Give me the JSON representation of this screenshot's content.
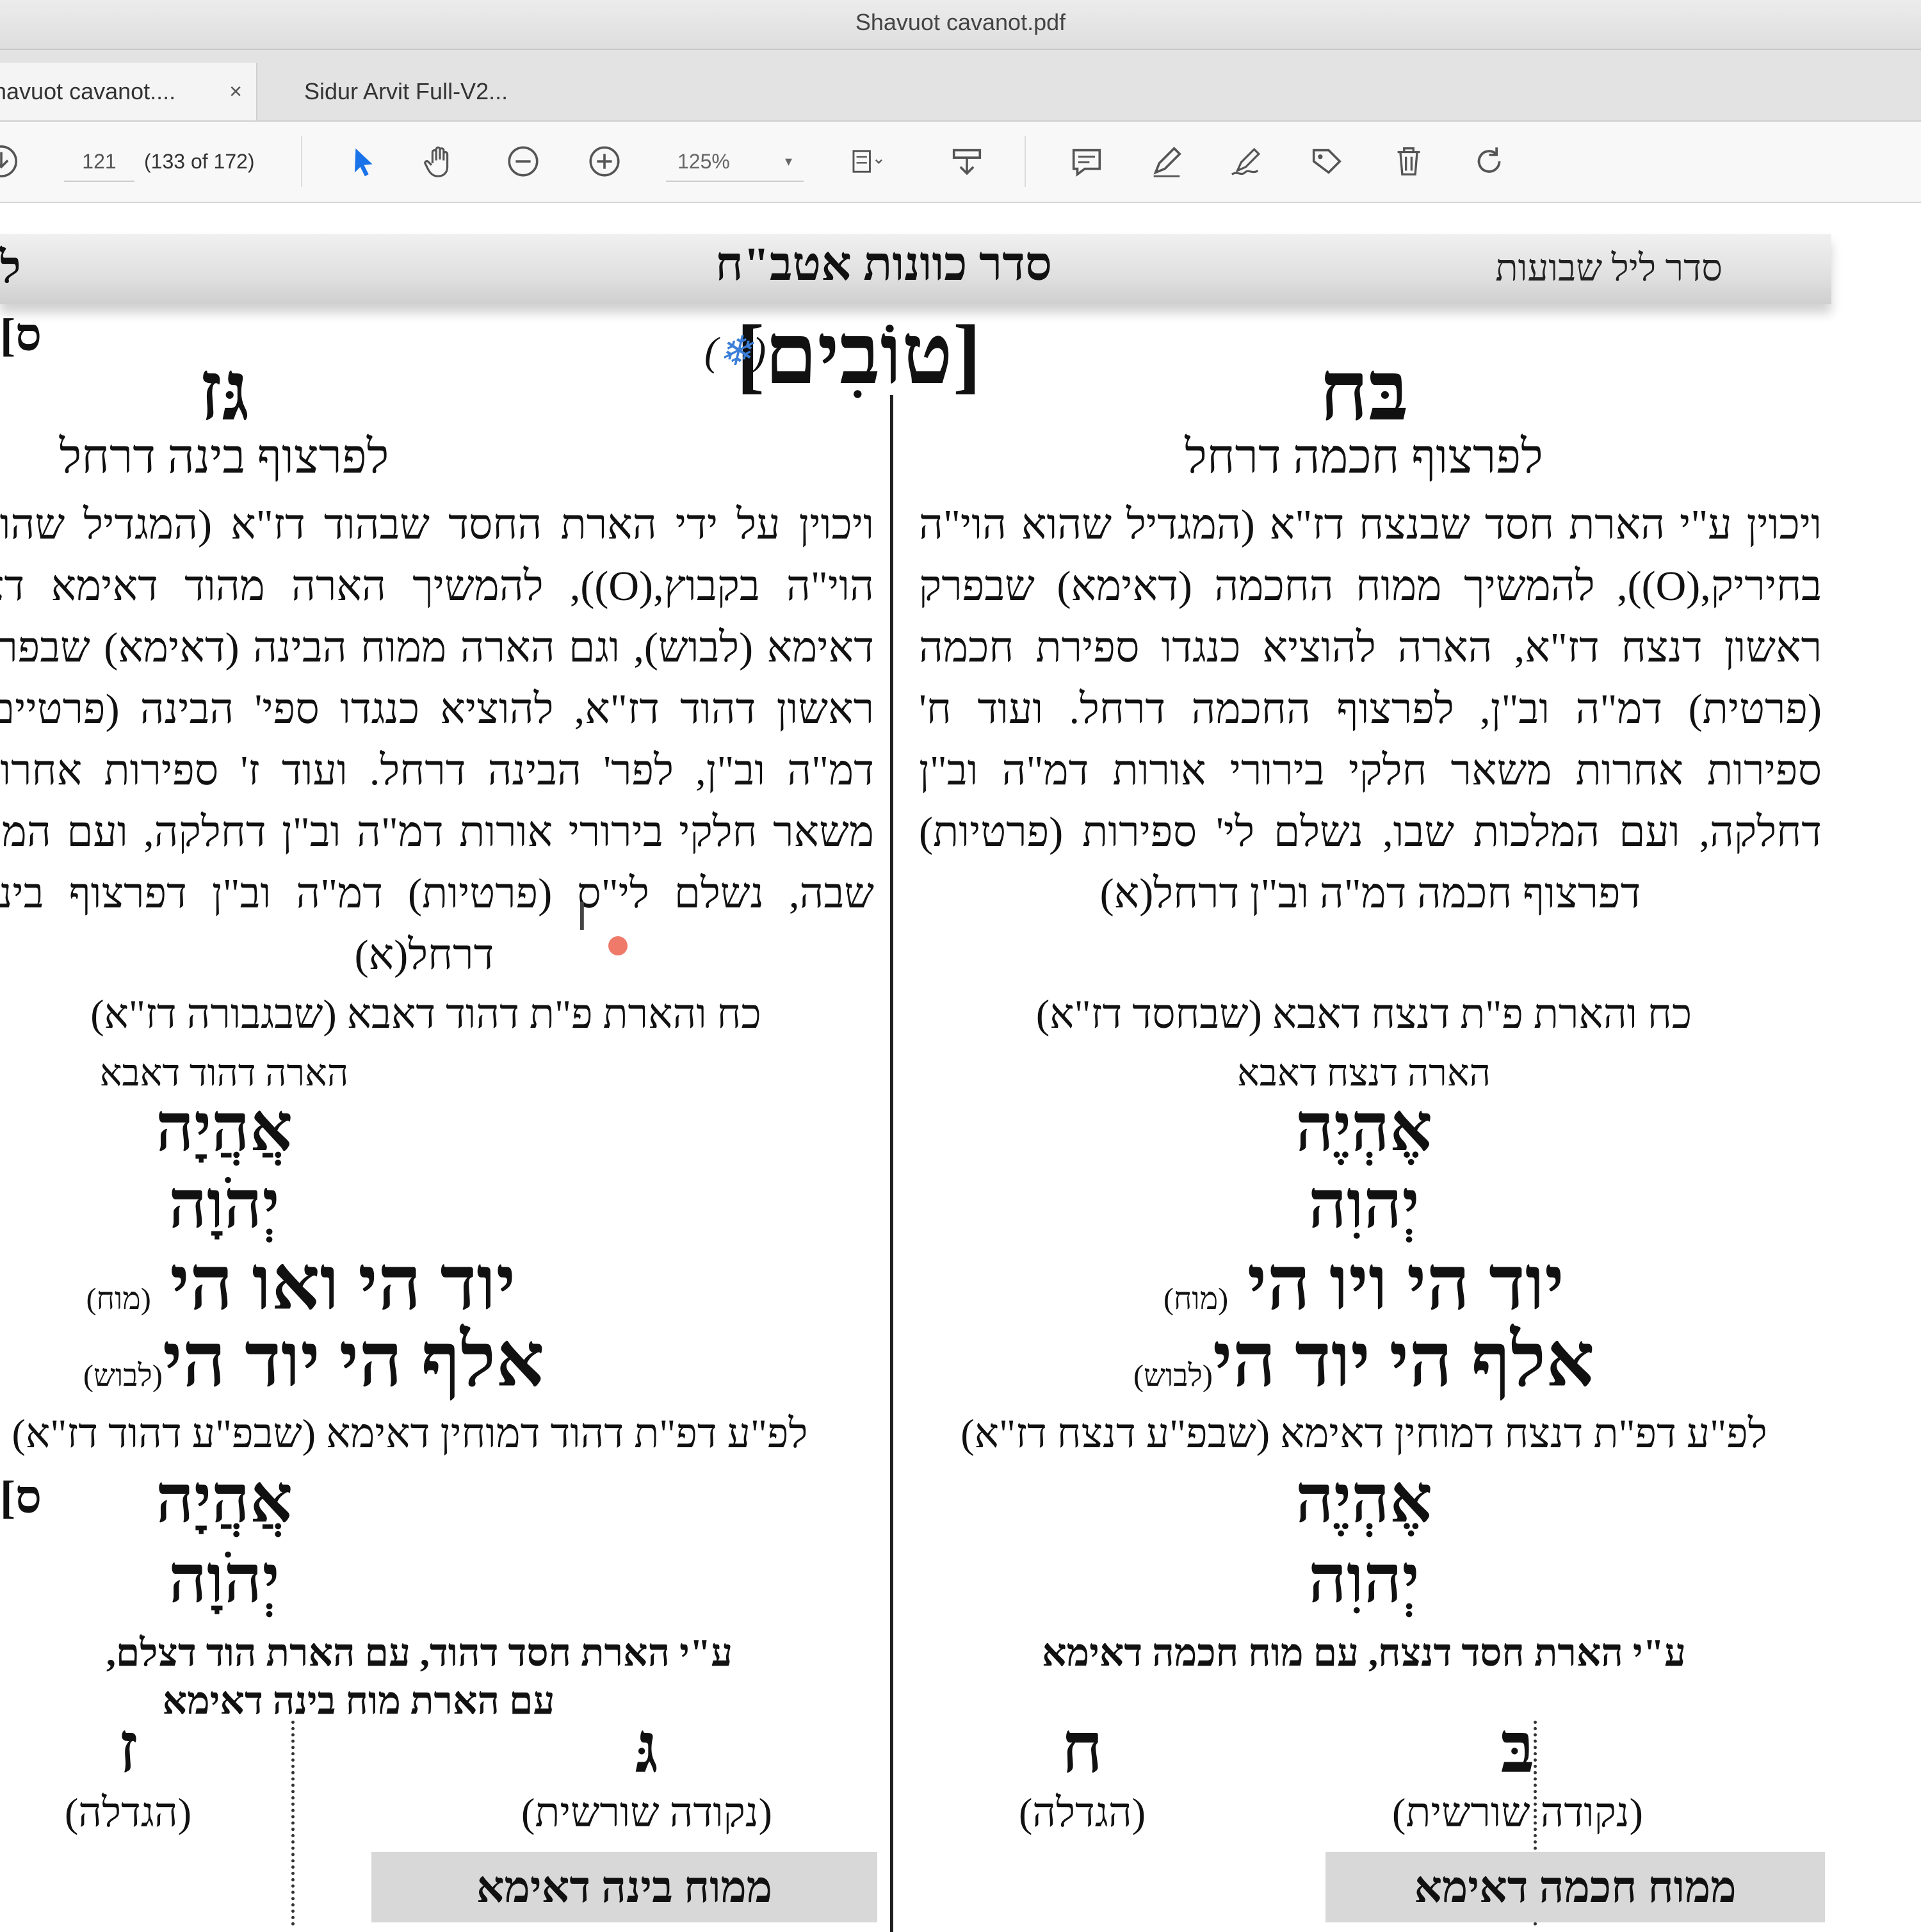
{
  "window": {
    "title": "Shavuot cavanot.pdf"
  },
  "tabs": [
    {
      "label": "havuot cavanot....",
      "close": "×"
    },
    {
      "label": "Sidur Arvit Full-V2..."
    }
  ],
  "toolbar": {
    "page_input": "121",
    "page_count": "(133 of 172)",
    "zoom": "125%",
    "zoom_caret": "▾"
  },
  "header": {
    "center": "סדר כוונות אטב\"ח",
    "right": "סדר ליל שבועות",
    "left_mark": "ל"
  },
  "tovim": {
    "title": "[טוֹבִים]",
    "note_open": "(",
    "note_star": "❄",
    "note_close": ")"
  },
  "edge_marks": [
    "[ס",
    "[ס"
  ],
  "right_col": {
    "letters": "בּח",
    "subtitle": "לפרצוף חכמה דרחל",
    "paragraph": "ויכוין ע\"י הארת חסד שבנצח דז\"א (המגדיל שהוא הוי\"ה בחיריק,(O)), להמשיך ממוח החכמה (דאימא) שבפרק ראשון דנצח דז\"א, הארה להוציא כנגדו ספירת חכמה (פרטית) דמ\"ה וב\"ן, לפרצוף החכמה דרחל. ועוד ח' ספירות אחרות משאר חלקי בירורי אורות דמ\"ה וב\"ן דחלקה, ועם המלכות שבו, נשלם לי' ספירות (פרטיות) דפרצוף חכמה דמ\"ה וב\"ן דרחל(א)",
    "koach": "כח והארת פ\"ת דנצח דאבא (שבחסד דז\"א)",
    "hara": "הארה דנצח דאבא",
    "names1": [
      "אֶהְיֶה",
      "יְהוִה"
    ],
    "milui1": "יוד הי ויו הי",
    "milui1_note": "(מוח)",
    "milui2": "אלף הי יוד הי",
    "milui2_note": "(לבוש)",
    "lefi": "לפ\"ע דפ\"ת דנצח דמוחין דאימא (שבפ\"ע דנצח דז\"א)",
    "names2": [
      "אֶהְיֶה",
      "יְהוִה"
    ],
    "al_yedei": "ע\"י הארת חסד דנצח, עם מוח חכמה דאימא",
    "nekuda_letter": "בּ",
    "nekuda_label": "(נקודה שורשית)",
    "hagdala_letter": "ח",
    "hagdala_label": "(הגדלה)",
    "gray_bar": "ממוח חכמה דאימא"
  },
  "left_col": {
    "letters": "גּז",
    "subtitle": "לפרצוף בינה דרחל",
    "paragraph": "ויכוין על ידי הארת החסד שבהוד דז\"א (המגדיל שהוא הוי\"ה בקבוץ,(O)), להמשיך הארה מהוד דאימא דצ' דאימא (לבוש), וגם הארה ממוח הבינה (דאימא) שבפרק ראשון דהוד דז\"א, להוציא כנגדו ספי' הבינה (פרטיים) דמ\"ה וב\"ן, לפר' הבינה דרחל. ועוד ז' ספירות אחרות משאר חלקי בירורי אורות דמ\"ה וב\"ן דחלקה, ועם המל' שבה, נשלם לי\"ס (פרטיות) דמ\"ה וב\"ן דפרצוף בינה דרחל(א)",
    "koach": "כח והארת פ\"ת דהוד דאבא (שבגבורה דז\"א)",
    "hara": "הארה דהוד דאבא",
    "names1": [
      "אֲהֲיָה",
      "יְהֹוָה"
    ],
    "milui1": "יוד הי ואו הי",
    "milui1_note": "(מוח)",
    "milui2": "אלף הי יוד הי",
    "milui2_note": "(לבוש)",
    "lefi": "לפ\"ע דפ\"ת דהוד דמוחין דאימא (שבפ\"ע דהוד דז\"א)",
    "names2": [
      "אֲהֲיָה",
      "יְהֹוָה"
    ],
    "al_yedei_1": "ע\"י הארת חסד דהוד, עם הארת הוד דצלם,",
    "al_yedei_2": "עם הארת מוח בינה דאימא",
    "nekuda_letter": "גּ",
    "nekuda_label": "(נקודה שורשית)",
    "hagdala_letter": "ז",
    "hagdala_label": "(הגדלה)",
    "gray_bar": "ממוח בינה דאימא"
  },
  "icons": [
    "download-icon",
    "select-arrow-icon",
    "hand-icon",
    "zoom-out-icon",
    "zoom-in-icon",
    "fit-page-icon",
    "stamp-icon",
    "comment-icon",
    "highlight-icon",
    "sign-icon",
    "tag-icon",
    "trash-icon",
    "rotate-icon"
  ],
  "colors": {
    "accent": "#1a73e8",
    "annotation_star": "#3b7fd8",
    "marker": "#f07a6a"
  }
}
